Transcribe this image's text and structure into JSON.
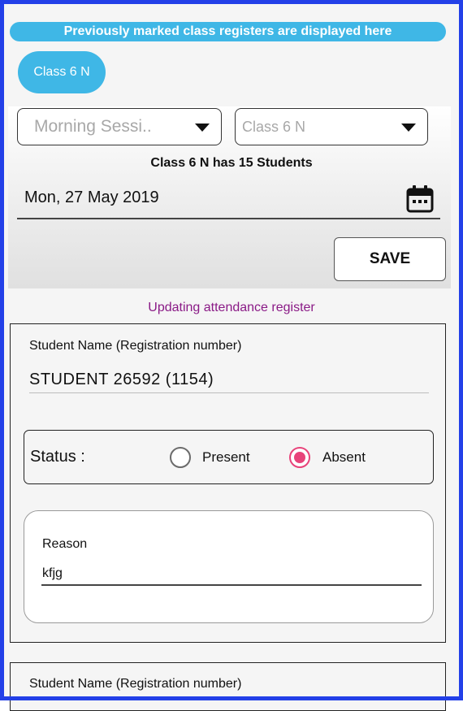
{
  "banner": "Previously marked class registers are displayed here",
  "class_chip": "Class 6 N",
  "session_dropdown": {
    "value": "Morning Sessi..",
    "icon": "caret-down-icon"
  },
  "class_dropdown": {
    "value": "Class 6 N",
    "icon": "caret-down-icon"
  },
  "student_count": "Class 6 N has 15 Students",
  "date": {
    "value": "Mon, 27 May 2019",
    "icon": "calendar-icon"
  },
  "save_label": "SAVE",
  "updating": "Updating attendance register",
  "records": [
    {
      "name_label": "Student Name (Registration number)",
      "name": "STUDENT  26592  (1154)",
      "status_label": "Status  :",
      "present_label": "Present",
      "absent_label": "Absent",
      "selected": "Absent",
      "reason_label": "Reason",
      "reason_value": "kfjg"
    },
    {
      "name_label": "Student Name (Registration number)"
    }
  ],
  "colors": {
    "accent": "#3fb7e6",
    "frame": "#2340e8",
    "radio_selected": "#e8437a",
    "updating_text": "#8a1a86"
  }
}
